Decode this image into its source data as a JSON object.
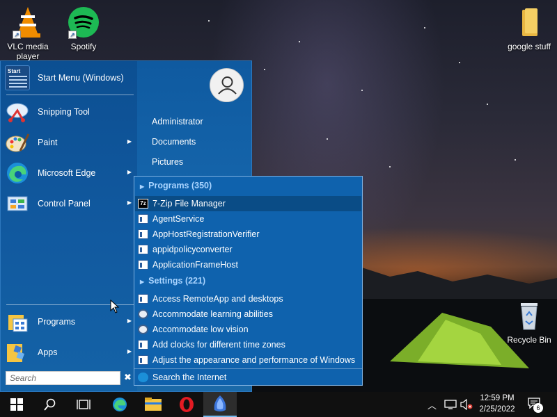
{
  "desktop": {
    "icons": [
      {
        "name": "vlc",
        "label_line1": "VLC media",
        "label_line2": "player"
      },
      {
        "name": "spotify",
        "label": "Spotify"
      },
      {
        "name": "google-stuff",
        "label": "google stuff"
      },
      {
        "name": "recycle-bin",
        "label": "Recycle Bin"
      }
    ]
  },
  "start_menu": {
    "left_items": [
      {
        "label": "Start Menu (Windows)",
        "icon": "start-menu-icon"
      },
      {
        "label": "Snipping Tool",
        "icon": "snipping-tool-icon"
      },
      {
        "label": "Paint",
        "icon": "paint-icon"
      },
      {
        "label": "Microsoft Edge",
        "icon": "edge-icon"
      },
      {
        "label": "Control Panel",
        "icon": "control-panel-icon"
      },
      {
        "label": "Programs",
        "icon": "programs-icon"
      },
      {
        "label": "Apps",
        "icon": "apps-icon"
      }
    ],
    "start_icon_text": "Start",
    "search": {
      "placeholder": "Search",
      "clear": "✖"
    },
    "right_items": [
      "Administrator",
      "Documents",
      "Pictures"
    ]
  },
  "results": {
    "programs_header": "Programs (350)",
    "programs": [
      "7-Zip File Manager",
      "AgentService",
      "AppHostRegistrationVerifier",
      "appidpolicyconverter",
      "ApplicationFrameHost"
    ],
    "settings_header": "Settings (221)",
    "settings": [
      "Access RemoteApp and desktops",
      "Accommodate learning abilities",
      "Accommodate low vision",
      "Add clocks for different time zones",
      "Adjust the appearance and performance of Windows"
    ],
    "internet": "Search the Internet",
    "zip_icon_text": "7z"
  },
  "taskbar": {
    "time": "12:59 PM",
    "date": "2/25/2022",
    "notification_count": "6",
    "active_app": "open-shell"
  },
  "colors": {
    "menu_blue": "#1565ab",
    "selected_row": "#0a4c86",
    "header_text": "#a9d4ff"
  }
}
